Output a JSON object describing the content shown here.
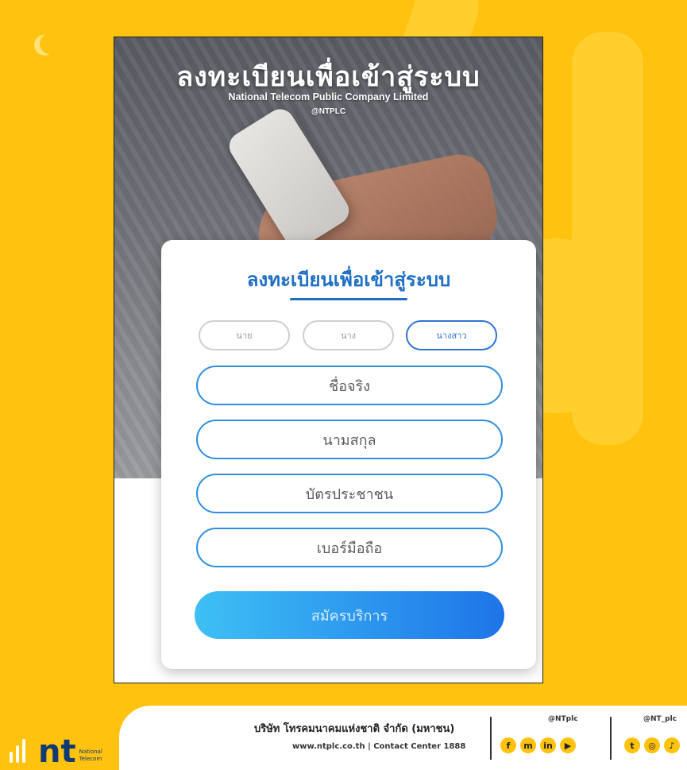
{
  "hero": {
    "title": "ลงทะเบียนเพื่อเข้าสู่ระบบ",
    "company_en": "National Telecom Public Company Limited",
    "handle": "@NTPLC"
  },
  "form": {
    "title": "ลงทะเบียนเพื่อเข้าสู่ระบบ",
    "title_options": [
      {
        "label": "นาย",
        "selected": false
      },
      {
        "label": "นาง",
        "selected": false
      },
      {
        "label": "นางสาว",
        "selected": true
      }
    ],
    "fields": [
      {
        "placeholder": "ชื่อจริง"
      },
      {
        "placeholder": "นามสกุล"
      },
      {
        "placeholder": "บัตรประชาชน"
      },
      {
        "placeholder": "เบอร์มือถือ"
      }
    ],
    "submit_label": "สมัครบริการ"
  },
  "footer": {
    "logo_text": "nt",
    "logo_sub_1": "National",
    "logo_sub_2": "Telecom",
    "company_th": "บริษัท โทรคมนาคมแห่งชาติ จำกัด (มหาชน)",
    "website": "www.ntplc.co.th",
    "contact": "Contact Center 1888",
    "handle_1": "@NTplc",
    "handle_2": "@NT_plc",
    "social_set_1": [
      "f",
      "m",
      "in",
      "▶"
    ],
    "social_set_2": [
      "t",
      "◎",
      "♪"
    ]
  },
  "colors": {
    "background": "#ffc20e",
    "accent": "#1f6fc5",
    "logo": "#113a73"
  }
}
